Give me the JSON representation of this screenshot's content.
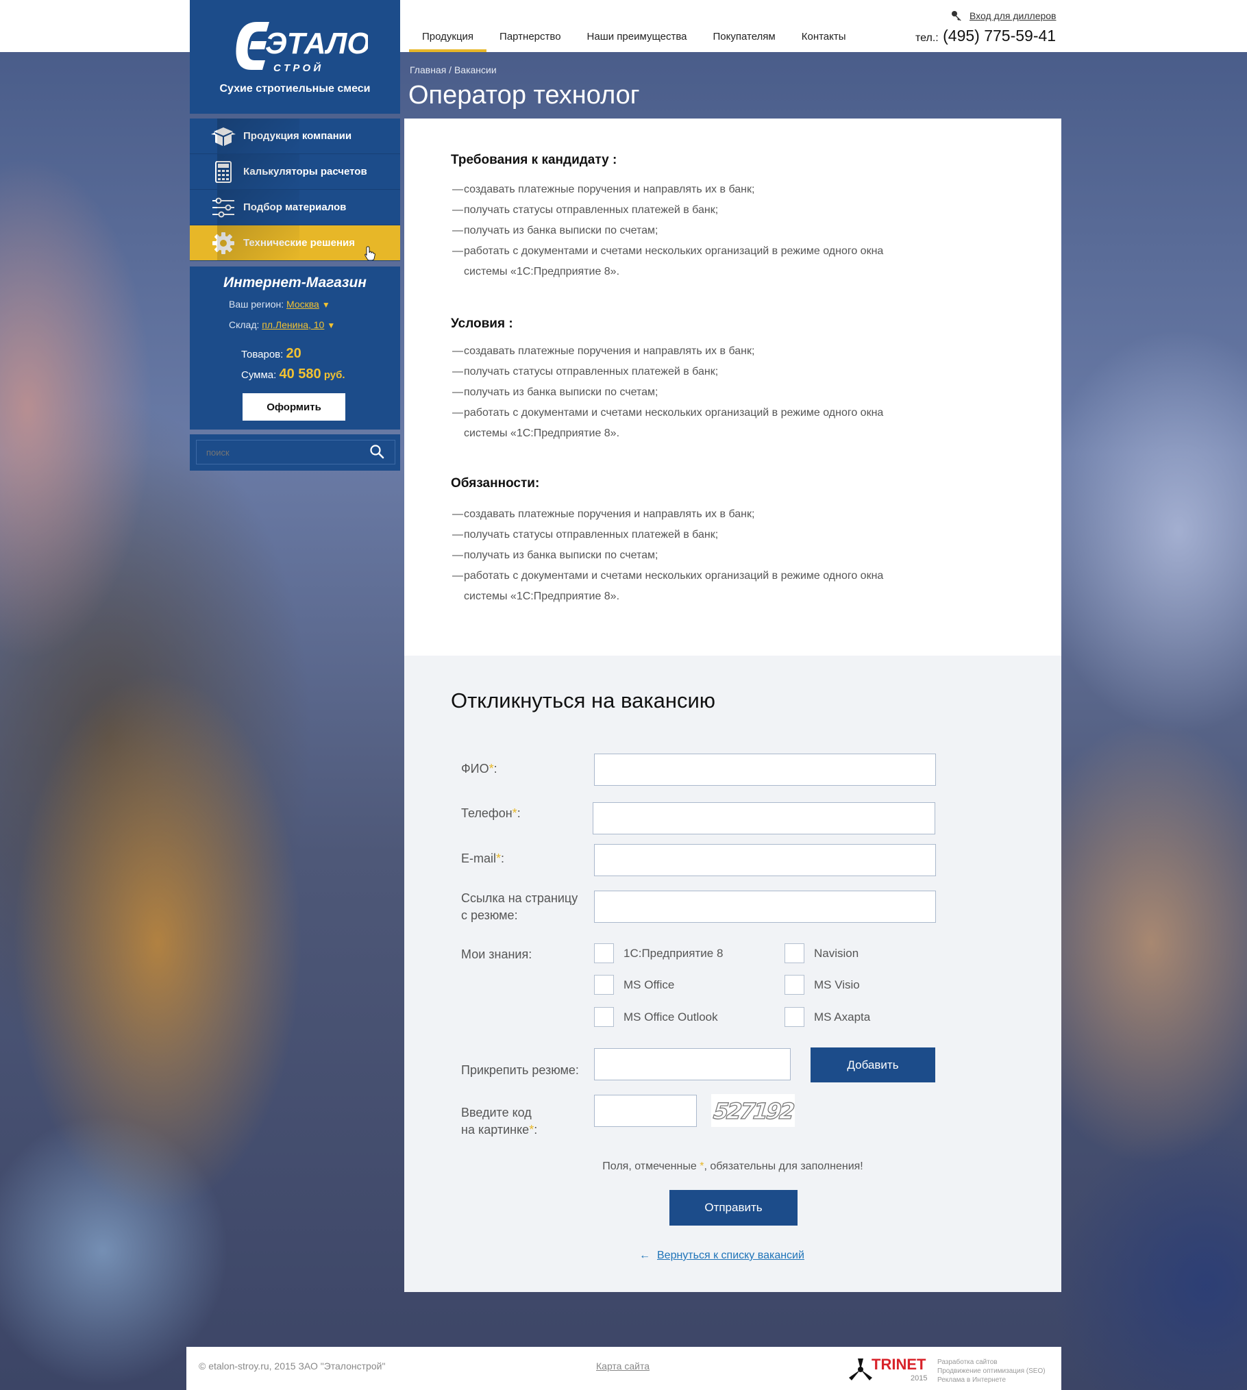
{
  "brand": {
    "logo_main": "ЭТАЛОН",
    "logo_sub": "С Т Р О Й",
    "tagline": "Сухие стротиельные смеси"
  },
  "nav": {
    "items": [
      "Продукция",
      "Партнерство",
      "Наши преимущества",
      "Покупателям",
      "Контакты"
    ],
    "active_index": 0,
    "dealer_login": "Вход для диллеров",
    "phone_prefix": "тел.:",
    "phone": "(495) 775-59-41"
  },
  "sidebar": {
    "menu": [
      {
        "label": "Продукция компании",
        "icon": "box-icon"
      },
      {
        "label": "Калькуляторы расчетов",
        "icon": "calculator-icon"
      },
      {
        "label": "Подбор материалов",
        "icon": "sliders-icon"
      },
      {
        "label": "Технические решения",
        "icon": "gear-icon",
        "active": true
      }
    ],
    "shop": {
      "title": "Интернет-Магазин",
      "region_label": "Ваш регион:",
      "region_value": "Москва",
      "warehouse_label": "Склад:",
      "warehouse_value": "пл.Ленина, 10",
      "goods_label": "Товаров:",
      "goods_count": "20",
      "sum_label": "Сумма:",
      "sum_value": "40 580",
      "currency": "руб.",
      "order_button": "Оформить"
    },
    "search": {
      "placeholder": "поиск"
    }
  },
  "breadcrumbs": "Главная / Вакансии",
  "page_title": "Оператор технолог",
  "sections": [
    {
      "title": "Требования к кандидату :",
      "items": [
        "создавать платежные поручения и направлять их в банк;",
        "получать статусы отправленных платежей в банк;",
        "получать из банка выписки по счетам;",
        "работать с документами и счетами нескольких организаций в режиме одного окна",
        "системы «1С:Предприятие 8»."
      ]
    },
    {
      "title": "Условия :",
      "items": [
        "создавать платежные поручения и направлять их в банк;",
        "получать статусы отправленных платежей в банк;",
        "получать из банка выписки по счетам;",
        "работать с документами и счетами нескольких организаций в режиме одного окна",
        "системы «1С:Предприятие 8»."
      ]
    },
    {
      "title": "Обязанности:",
      "items": [
        "создавать платежные поручения и направлять их в банк;",
        "получать статусы отправленных платежей в банк;",
        "получать из банка выписки по счетам;",
        "работать с документами и счетами нескольких организаций в режиме одного окна",
        "системы «1С:Предприятие 8»."
      ]
    }
  ],
  "form": {
    "title": "Откликнуться на вакансию",
    "fio_label": "ФИО",
    "phone_label": "Телефон",
    "email_label": "E-mail",
    "resume_link_label_1": "Ссылка на страницу",
    "resume_link_label_2": "с резюме:",
    "knowledge_label": "Мои знания:",
    "skills": [
      "1С:Предприятие 8",
      "Navision",
      "MS Office",
      "MS Visio",
      "MS Office Outlook",
      "MS Axapta"
    ],
    "attach_label": "Прикрепить резюме:",
    "add_button": "Добавить",
    "captcha_label_1": "Введите код",
    "captcha_label_2": "на картинке",
    "captcha_text": "527192",
    "required_asterisk": "*",
    "colon": ":",
    "note_before": "Поля, отмеченные",
    "note_after": ", обязательны для заполнения!",
    "submit_button": "Отправить",
    "back_arrow": "←",
    "back_link": "Вернуться к списку вакансий"
  },
  "footer": {
    "copyright": "© etalon-stroy.ru, 2015 ЗАО \"Эталонстрой\"",
    "sitemap": "Карта сайта",
    "dev_name": "TRINET",
    "dev_year": "2015",
    "dev_lines": [
      "Разработка сайтов",
      "Продвижение оптимизация (SEO)",
      "Реклама в Интернете"
    ]
  }
}
